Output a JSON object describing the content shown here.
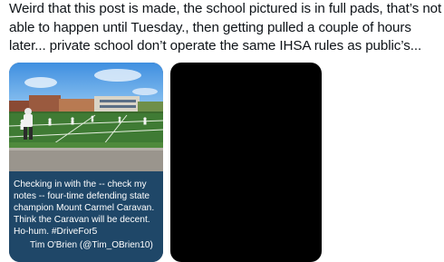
{
  "post": {
    "lines": [
      "Weird that this post is made, the school pictured is in full pads, that’s not",
      "able to happen until Tuesday., then getting pulled a couple of hours",
      "later... private school don’t operate the same IHSA rules as public’s..."
    ]
  },
  "embedded_tweet": {
    "text": "Checking in with the -- check my notes -- four-time defending state champion Mount Carmel Caravan. Think the Caravan will be decent. Ho-hum. #DriveFor5",
    "author": "Tim O'Brien (@Tim_OBrien10)"
  },
  "colors": {
    "quote_background": "#1f4768",
    "blacked_out_card": "#000000"
  }
}
